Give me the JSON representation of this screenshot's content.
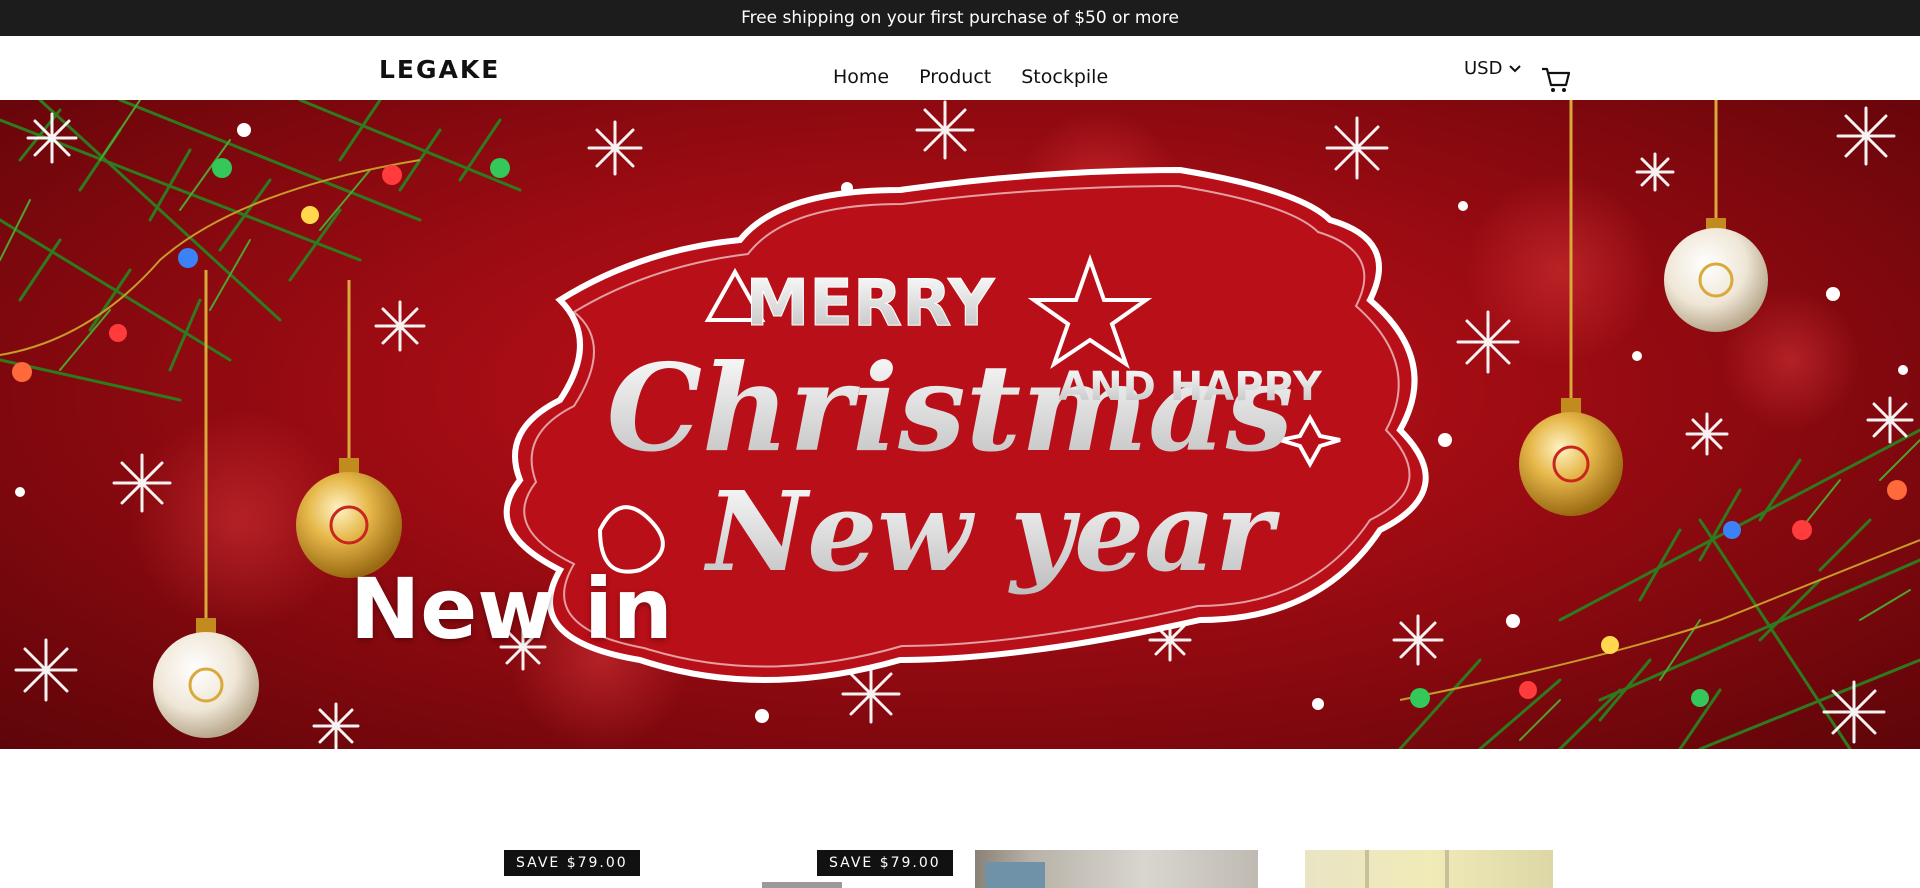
{
  "announcement": "Free shipping on your first purchase of $50 or more",
  "header": {
    "logo": "LEGAKE",
    "nav": [
      {
        "label": "Home"
      },
      {
        "label": "Product"
      },
      {
        "label": "Stockpile"
      }
    ],
    "currency": "USD",
    "icons": {
      "currency": "chevron-down-icon",
      "cart": "cart-icon"
    }
  },
  "hero": {
    "title": "New in",
    "banner_text": {
      "line1": "MERRY",
      "line2": "Christmas",
      "line3": "AND HAPPY",
      "line4": "New year"
    }
  },
  "products": [
    {
      "badge": "SAVE $79.00"
    },
    {
      "badge": "SAVE $79.00"
    },
    {
      "badge": ""
    },
    {
      "badge": ""
    }
  ],
  "colors": {
    "announce_bg": "#1c1c1c",
    "hero_red": "#b30f16",
    "gold": "#d9a93a",
    "pine": "#2f7a1e"
  }
}
